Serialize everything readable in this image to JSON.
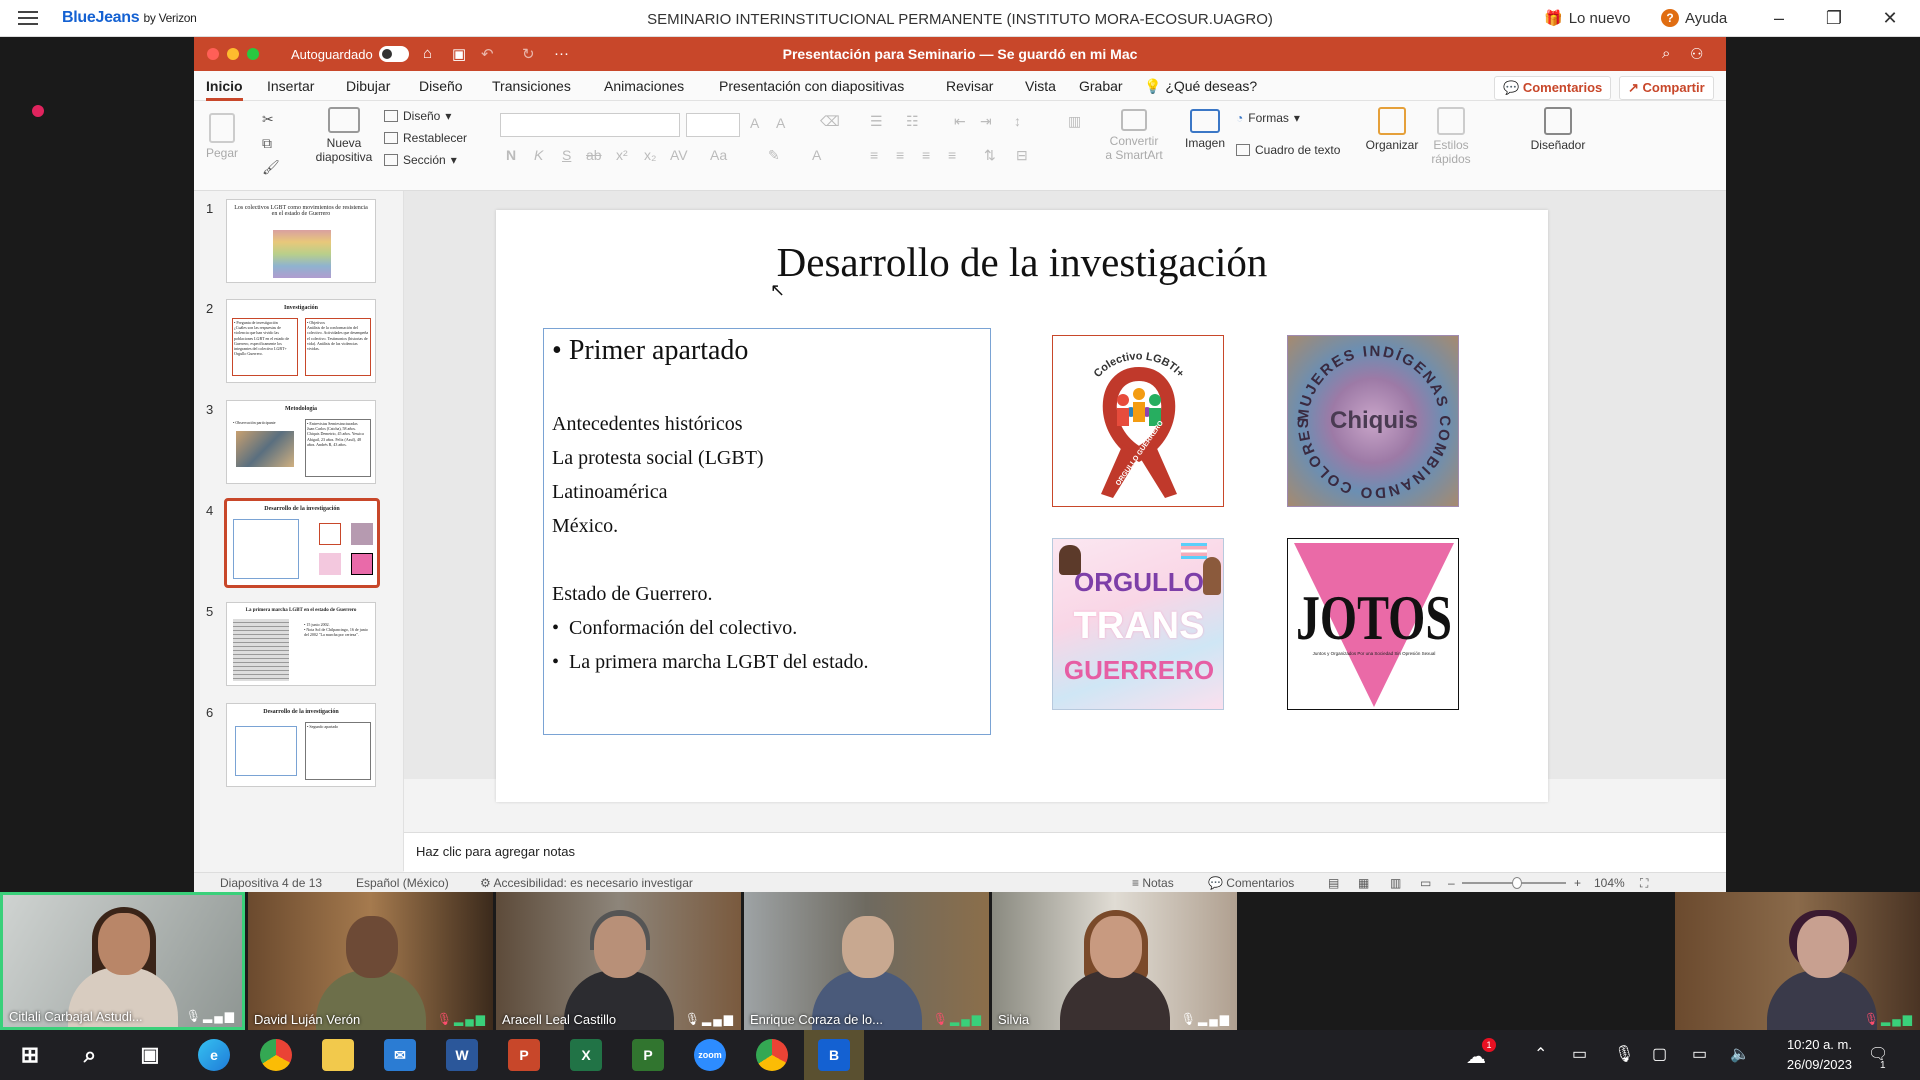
{
  "bluejeans": {
    "brand": "BlueJeans",
    "brand_suffix": "by Verizon",
    "meeting_title": "SEMINARIO INTERINSTITUCIONAL PERMANENTE (INSTITUTO MORA-ECOSUR.UAGRO)",
    "whats_new": "Lo nuevo",
    "help": "Ayuda"
  },
  "ppt": {
    "autosave_label": "Autoguardado",
    "autosave_state": "O",
    "doc_title": "Presentación para Seminario — Se guardó en mi Mac",
    "tabs": [
      "Inicio",
      "Insertar",
      "Dibujar",
      "Diseño",
      "Transiciones",
      "Animaciones",
      "Presentación con diapositivas",
      "Revisar",
      "Vista",
      "Grabar",
      "¿Qué deseas?"
    ],
    "comments_btn": "Comentarios",
    "share_btn": "Compartir",
    "ribbon": {
      "paste": "Pegar",
      "new_slide_1": "Nueva",
      "new_slide_2": "diapositiva",
      "layout": "Diseño",
      "reset": "Restablecer",
      "section": "Sección",
      "smartart_1": "Convertir",
      "smartart_2": "a SmartArt",
      "image": "Imagen",
      "shapes": "Formas",
      "textbox": "Cuadro de texto",
      "arrange": "Organizar",
      "quick_styles_1": "Estilos",
      "quick_styles_2": "rápidos",
      "designer": "Diseñador"
    },
    "thumbnails": [
      {
        "num": "1",
        "title": "Los colectivos LGBT como movimientos de resistencia en el estado de Guerrero"
      },
      {
        "num": "2",
        "title": "Investigación",
        "left": "• Pregunta de investigación",
        "left_body": "¿Cuáles son las respuestas de violencia que han vivido las poblaciones LGBT en el estado de Guerrero, específicamente los integrantes del colectivo LGBT+ Orgullo Guerrero.",
        "right": "• Objetivos",
        "right_body": "Análisis de la conformación del colectivo. Actividades que desempeña el colectivo. Testimonios (historias de vida). Análisis de las violencias vividas."
      },
      {
        "num": "3",
        "title": "Metodología",
        "left": "• Observación participante",
        "right": "• Entrevistas Semiestructuradas",
        "right_body": "Juan Carlos (Catcha), 58 años. Chiquis Demetrio, 45 años. Yessica Abigail, 23 años. Felix (Azul), 48 años. Andrés R, 43 años."
      },
      {
        "num": "4",
        "title": "Desarrollo de la investigación"
      },
      {
        "num": "5",
        "title": "La primera marcha LGBT en el estado de Guerrero",
        "right": "• 15 junio 2002.",
        "right_body": "• Nota Sol de Chilpancingo, 16 de junio del 2002 \"La marcha por certeza\"."
      },
      {
        "num": "6",
        "title": "Desarrollo de la investigación",
        "right": "• Segundo apartado"
      }
    ],
    "slide": {
      "title": "Desarrollo de la investigación",
      "bullet_heading": "Primer apartado",
      "lines": [
        "Antecedentes históricos",
        "La protesta social (LGBT)",
        "Latinoamérica",
        "México."
      ],
      "state_line": "Estado de Guerrero.",
      "sub_bullets": [
        "Conformación del colectivo.",
        "La primera marcha LGBT del estado."
      ],
      "images": {
        "colectivo_top": "Colectivo LGBTI+",
        "colectivo_ribbon": "ORGULLO GUERRERO",
        "chiquis_ring": "MUJERES INDÍGENAS COMBINANDO COLORES",
        "chiquis_name": "Chiquis",
        "trans_1": "ORGULLO",
        "trans_2": "TRANS",
        "trans_3": "GUERRERO",
        "jotos": "JOTOS",
        "jotos_sub": "Juntos y Organizados Por una Sociedad Sin Opresión Sexual"
      }
    },
    "notes_placeholder": "Haz clic para agregar notas",
    "status": {
      "slide_of": "Diapositiva 4 de 13",
      "language": "Español (México)",
      "accessibility": "Accesibilidad: es necesario investigar",
      "notes": "Notas",
      "comments": "Comentarios",
      "zoom": "104%"
    }
  },
  "participants": [
    {
      "name": "Citlali Carbajal Astudi...",
      "mic": "on"
    },
    {
      "name": "David Luján Verón",
      "mic": "muted"
    },
    {
      "name": "Aracell Leal Castillo",
      "mic": "on"
    },
    {
      "name": "Enrique Coraza de lo...",
      "mic": "muted"
    },
    {
      "name": "Silvia",
      "mic": "on"
    }
  ],
  "taskbar": {
    "apps": [
      "windows-start",
      "search",
      "task-view",
      "edge",
      "chrome",
      "file-explorer",
      "mail",
      "word",
      "powerpoint",
      "excel",
      "project",
      "zoom",
      "chrome-profile",
      "bluejeans"
    ],
    "word": "W",
    "powerpoint": "P",
    "excel": "X",
    "project": "P",
    "zoom": "zoom",
    "bluejeans": "B",
    "weather_badge": "1",
    "time": "10:20 a. m.",
    "date": "26/09/2023",
    "notification_count": "1"
  }
}
